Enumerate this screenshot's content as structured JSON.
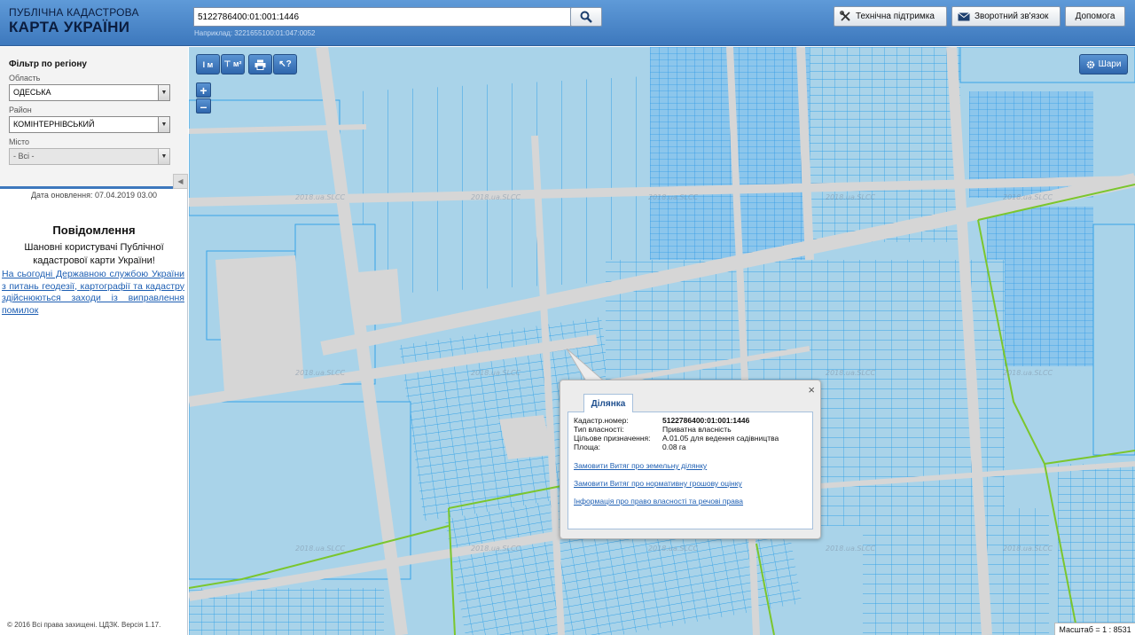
{
  "header": {
    "logo_line1": "ПУБЛІЧНА КАДАСТРОВА",
    "logo_line2": "КАРТА УКРАЇНИ",
    "search_value": "5122786400:01:001:1446",
    "search_example": "Наприклад: 3221655100:01:047:0052",
    "search_icon": "search-icon",
    "buttons": [
      {
        "label": "Технічна підтримка",
        "icon": "tools-icon"
      },
      {
        "label": "Зворотний зв'язок",
        "icon": "envelope-icon"
      },
      {
        "label": "Допомога"
      }
    ]
  },
  "sidebar": {
    "filter_title": "Фільтр по регіону",
    "region_label": "Область",
    "region_value": "ОДЕСЬКА",
    "district_label": "Район",
    "district_value": "КОМІНТЕРНІВСЬКИЙ",
    "city_label": "Місто",
    "city_value": "- Всі -",
    "collapse_glyph": "◀",
    "update_text": "Дата оновлення: 07.04.2019 03.00",
    "notice_title": "Повідомлення",
    "notice_greeting": "Шановні користувачі Публічної кадастрової карти України!",
    "notice_link": "На сьогодні Державною службою України з питань геодезії, картографії та кадастру здійснюються заходи із виправлення помилок",
    "copyright": "© 2016 Всі права захищені. ЦДЗК. Версія 1.17."
  },
  "map": {
    "tools": [
      {
        "name": "measure-length-tool",
        "glyph": "I м"
      },
      {
        "name": "measure-area-tool",
        "glyph": "⊤ м²"
      },
      {
        "name": "print-tool",
        "glyph": "print-icon"
      },
      {
        "name": "identify-tool",
        "glyph": "↖?"
      }
    ],
    "zoom_in": "+",
    "zoom_out": "–",
    "layers_label": "Шари",
    "watermark": "2018.ua.SLCC",
    "scale_text": "Масштаб = 1 : 8531",
    "colors": {
      "parcel_fill": "#a9d3e9",
      "parcel_line": "#36a3e8",
      "road": "#d8d8d8",
      "boundary": "#7bc62d",
      "accent": "#3d78bd"
    }
  },
  "popup": {
    "tab": "Ділянка",
    "close": "×",
    "rows": [
      {
        "key": "Кадастр.номер:",
        "value": "5122786400:01:001:1446"
      },
      {
        "key": "Тип власності:",
        "value": "Приватна власність"
      },
      {
        "key": "Цільове призначення:",
        "value": "A.01.05 для ведення садівництва"
      },
      {
        "key": "Площа:",
        "value": "0.08 га"
      }
    ],
    "links": [
      "Замовити Витяг про земельну ділянку",
      "Замовити Витяг про нормативну грошову оцінку",
      "Інформація про право власності та речові права"
    ]
  }
}
